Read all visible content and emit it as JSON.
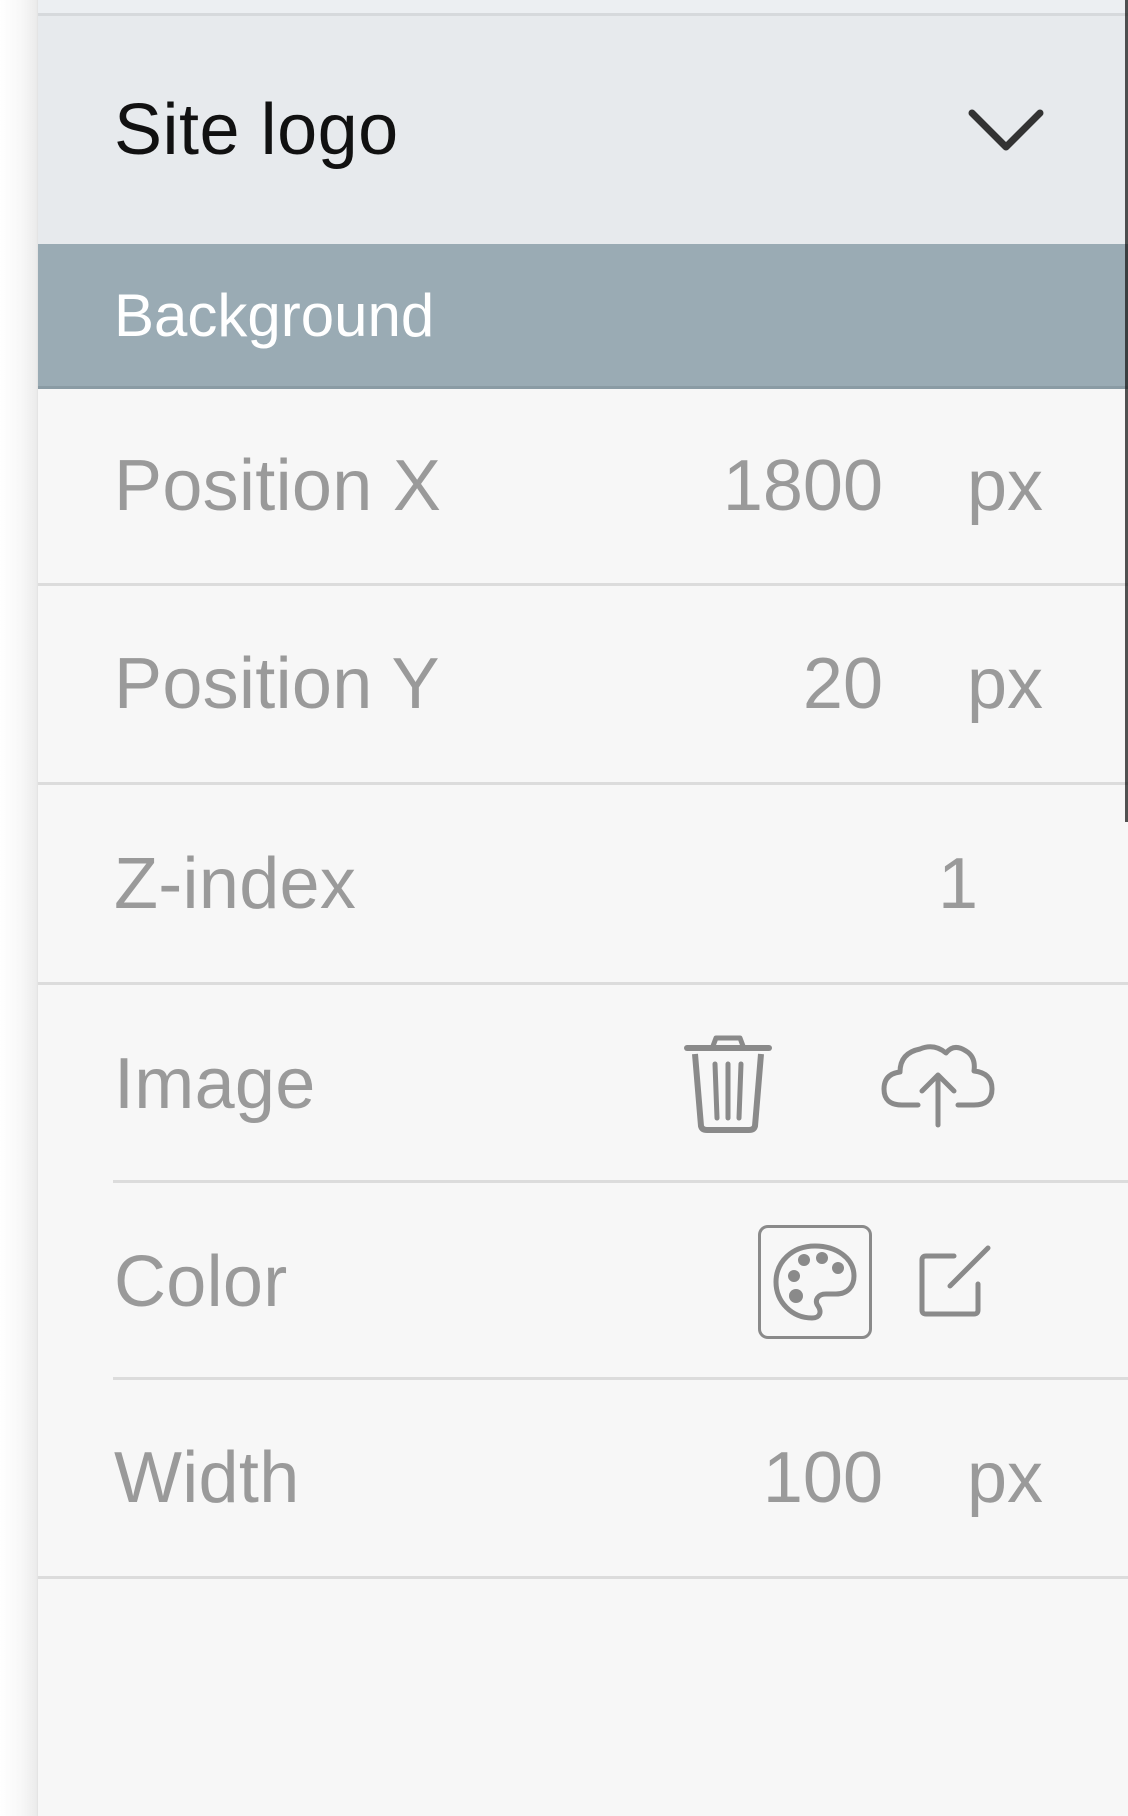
{
  "panel": {
    "header": {
      "title": "Site logo",
      "chevron_icon": "chevron-down-icon"
    },
    "section": {
      "title": "Background"
    },
    "rows": {
      "position_x": {
        "label": "Position X",
        "value": "1800",
        "unit": "px"
      },
      "position_y": {
        "label": "Position Y",
        "value": "20",
        "unit": "px"
      },
      "z_index": {
        "label": "Z-index",
        "value": "1"
      },
      "image": {
        "label": "Image",
        "icons": [
          "trash-icon",
          "cloud-upload-icon"
        ]
      },
      "color": {
        "label": "Color",
        "icons": [
          "palette-icon",
          "edit-icon"
        ]
      },
      "width": {
        "label": "Width",
        "value": "100",
        "unit": "px"
      }
    }
  },
  "colors": {
    "header_bg": "#e7eaed",
    "section_bg": "#9aabb4",
    "panel_bg": "#f7f7f7",
    "label_text": "#9a9a9a"
  }
}
